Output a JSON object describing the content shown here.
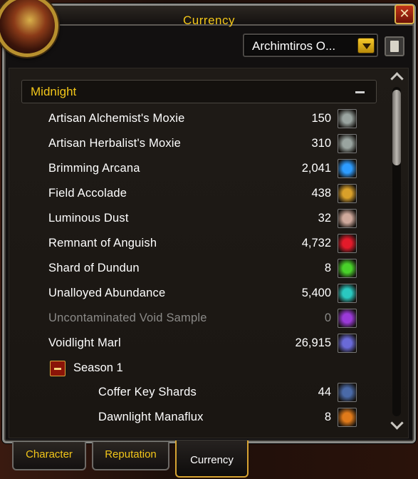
{
  "window": {
    "title": "Currency",
    "close_label": "✕"
  },
  "character_dropdown": {
    "selected": "Archimtiros O..."
  },
  "category": {
    "label": "Midnight",
    "toggle_state": "expanded"
  },
  "rows": [
    {
      "name": "Artisan Alchemist's Moxie",
      "value": "150",
      "icon": "moxie-icon",
      "color": "#9aa4a0"
    },
    {
      "name": "Artisan Herbalist's Moxie",
      "value": "310",
      "icon": "moxie-icon",
      "color": "#9aa4a0"
    },
    {
      "name": "Brimming Arcana",
      "value": "2,041",
      "icon": "arcana-orb-icon",
      "color": "#2d9cff"
    },
    {
      "name": "Field Accolade",
      "value": "438",
      "icon": "wings-badge-icon",
      "color": "#d9a02a"
    },
    {
      "name": "Luminous Dust",
      "value": "32",
      "icon": "dust-icon",
      "color": "#cfa99c"
    },
    {
      "name": "Remnant of Anguish",
      "value": "4,732",
      "icon": "red-orb-icon",
      "color": "#e21a2a"
    },
    {
      "name": "Shard of Dundun",
      "value": "8",
      "icon": "green-shard-icon",
      "color": "#49d12a"
    },
    {
      "name": "Unalloyed Abundance",
      "value": "5,400",
      "icon": "cyan-orb-icon",
      "color": "#2ac8c0"
    },
    {
      "name": "Uncontaminated Void Sample",
      "value": "0",
      "icon": "void-swirl-icon",
      "color": "#9a3ad8",
      "disabled": true
    },
    {
      "name": "Voidlight Marl",
      "value": "26,915",
      "icon": "voidlight-crystal-icon",
      "color": "#6a6ad8"
    }
  ],
  "subcategory": {
    "label": "Season 1",
    "toggle_state": "expanded"
  },
  "sub_rows": [
    {
      "name": "Coffer Key Shards",
      "value": "44",
      "icon": "key-shard-icon",
      "color": "#4a6aa8"
    },
    {
      "name": "Dawnlight Manaflux",
      "value": "8",
      "icon": "manaflux-flask-icon",
      "color": "#e07a1a"
    }
  ],
  "tabs": [
    {
      "label": "Character",
      "active": false
    },
    {
      "label": "Reputation",
      "active": false
    },
    {
      "label": "Currency",
      "active": true
    }
  ]
}
